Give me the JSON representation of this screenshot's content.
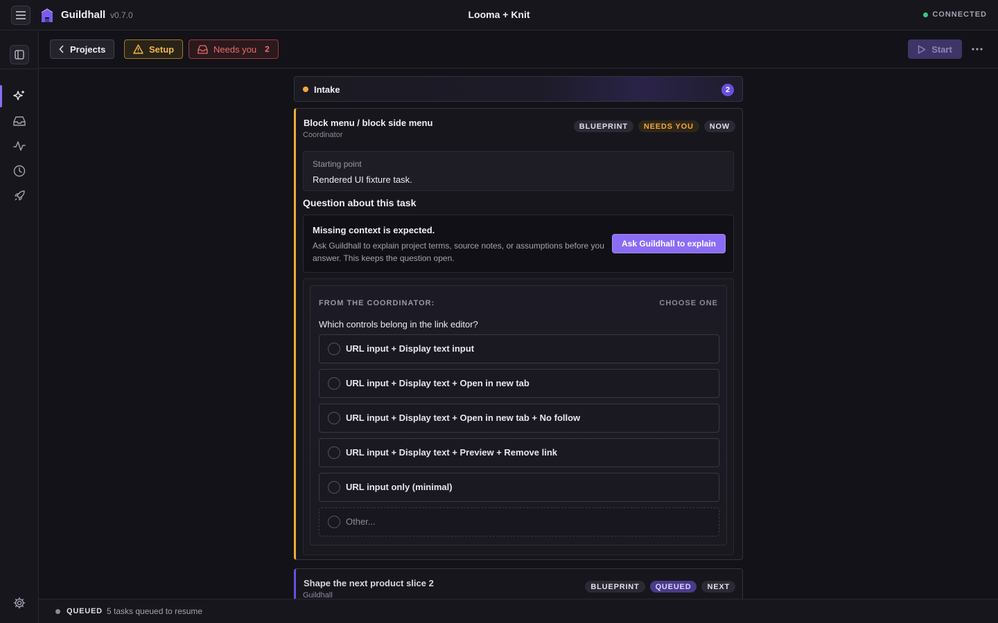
{
  "app": {
    "name": "Guildhall",
    "version": "v0.7.0",
    "window_title": "Looma + Knit",
    "connection_status": "CONNECTED",
    "connection_color": "#34c98a"
  },
  "toolbar": {
    "projects_label": "Projects",
    "setup_label": "Setup",
    "needs_you_label": "Needs you",
    "needs_you_count": "2",
    "start_label": "Start",
    "more_icon": "more-horizontal-icon"
  },
  "sidebar": {
    "items": [
      {
        "icon": "sparkle-icon",
        "active": true
      },
      {
        "icon": "inbox-icon",
        "active": false
      },
      {
        "icon": "activity-icon",
        "active": false
      },
      {
        "icon": "clock-icon",
        "active": false
      },
      {
        "icon": "rocket-icon",
        "active": false
      }
    ],
    "settings_icon": "gear-icon",
    "accent": "#8b6cf5"
  },
  "intake": {
    "label": "Intake",
    "count": "2"
  },
  "task": {
    "title": "Block menu / block side menu",
    "owner": "Coordinator",
    "badges": [
      "BLUEPRINT",
      "NEEDS YOU",
      "NOW"
    ],
    "starting_point_label": "Starting point",
    "starting_point_text": "Rendered UI fixture task.",
    "question_heading": "Question about this task",
    "context_title": "Missing context is expected.",
    "context_body": "Ask Guildhall to explain project terms, source notes, or assumptions before you answer. This keeps the question open.",
    "ask_button": "Ask Guildhall to explain",
    "question": {
      "from_label": "FROM THE COORDINATOR:",
      "mode_label": "CHOOSE ONE",
      "text": "Which controls belong in the link editor?",
      "options": [
        "URL input + Display text input",
        "URL input + Display text + Open in new tab",
        "URL input + Display text + Open in new tab + No follow",
        "URL input + Display text + Preview + Remove link",
        "URL input only (minimal)",
        "Other..."
      ]
    }
  },
  "next_task": {
    "title": "Shape the next product slice 2",
    "owner": "Guildhall",
    "badges": [
      "BLUEPRINT",
      "QUEUED",
      "NEXT"
    ]
  },
  "status": {
    "label": "QUEUED",
    "text": "5 tasks queued to resume"
  }
}
